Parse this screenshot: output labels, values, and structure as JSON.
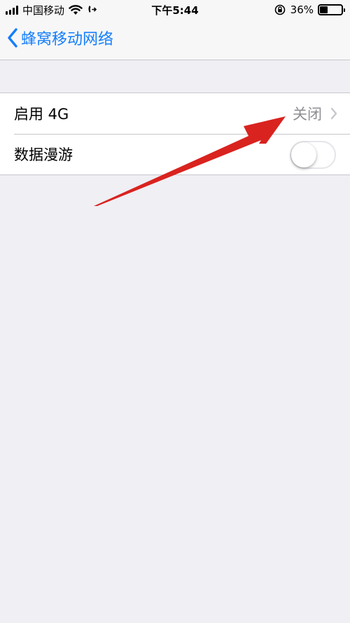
{
  "status_bar": {
    "carrier": "中国移动",
    "time": "下午5:44",
    "battery_text": "36%",
    "battery_level": 0.36,
    "icons": [
      "signal-bars-icon",
      "wifi-icon",
      "call-forward-icon",
      "orientation-lock-icon",
      "battery-icon"
    ]
  },
  "nav": {
    "back_label": "蜂窝移动网络",
    "back_icon": "chevron-left-icon",
    "accent_color": "#157efb"
  },
  "settings": {
    "rows": [
      {
        "label": "启用 4G",
        "value": "关闭",
        "icon": "chevron-right-icon"
      },
      {
        "label": "数据漫游",
        "toggle": false
      }
    ]
  },
  "annotation": {
    "arrow_color": "#d9231f",
    "icon": "red-arrow-icon"
  }
}
